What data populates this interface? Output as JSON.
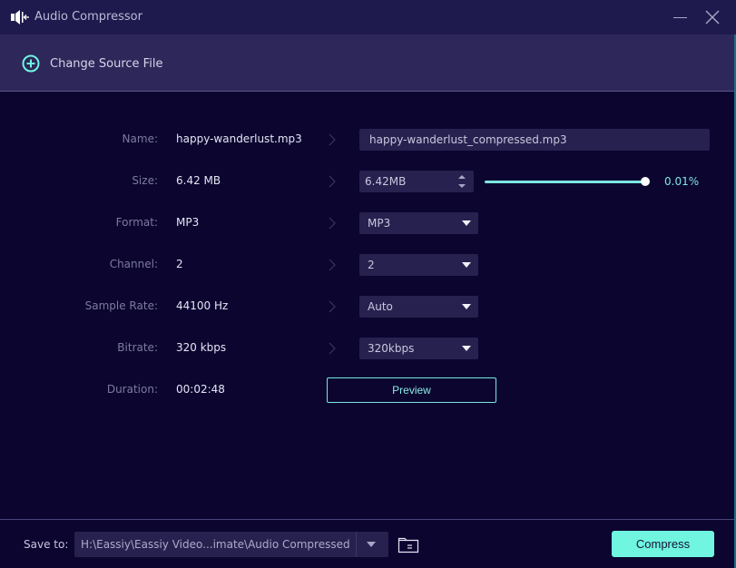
{
  "window": {
    "title": "Audio Compressor",
    "icons": {
      "app": "speaker-compress-icon",
      "minimize": "minimize-icon",
      "close": "close-icon"
    }
  },
  "toolbar": {
    "change_source_label": "Change Source File",
    "change_source_icon": "plus-circle-icon"
  },
  "form": {
    "rows": [
      {
        "label": "Name:",
        "source": "happy-wanderlust.mp3",
        "output": "happy-wanderlust_compressed.mp3"
      },
      {
        "label": "Size:",
        "source": "6.42 MB",
        "output": "6.42MB"
      },
      {
        "label": "Format:",
        "source": "MP3",
        "output": "MP3"
      },
      {
        "label": "Channel:",
        "source": "2",
        "output": "2"
      },
      {
        "label": "Sample Rate:",
        "source": "44100 Hz",
        "output": "Auto"
      },
      {
        "label": "Bitrate:",
        "source": "320 kbps",
        "output": "320kbps"
      },
      {
        "label": "Duration:",
        "source": "00:02:48"
      }
    ],
    "size_slider": {
      "fill_fraction": 1.0,
      "percent_label": "0.01%"
    },
    "preview_label": "Preview"
  },
  "footer": {
    "save_to_label": "Save to:",
    "save_path": "H:\\Eassiy\\Eassiy Video...imate\\Audio Compressed",
    "compress_label": "Compress",
    "folder_icon": "folder-icon"
  },
  "colors": {
    "accent": "#6ff5e0",
    "background": "#0b0530",
    "titlebar": "#1f1a4d",
    "toolbar": "#2e2759",
    "field": "#27214f"
  }
}
